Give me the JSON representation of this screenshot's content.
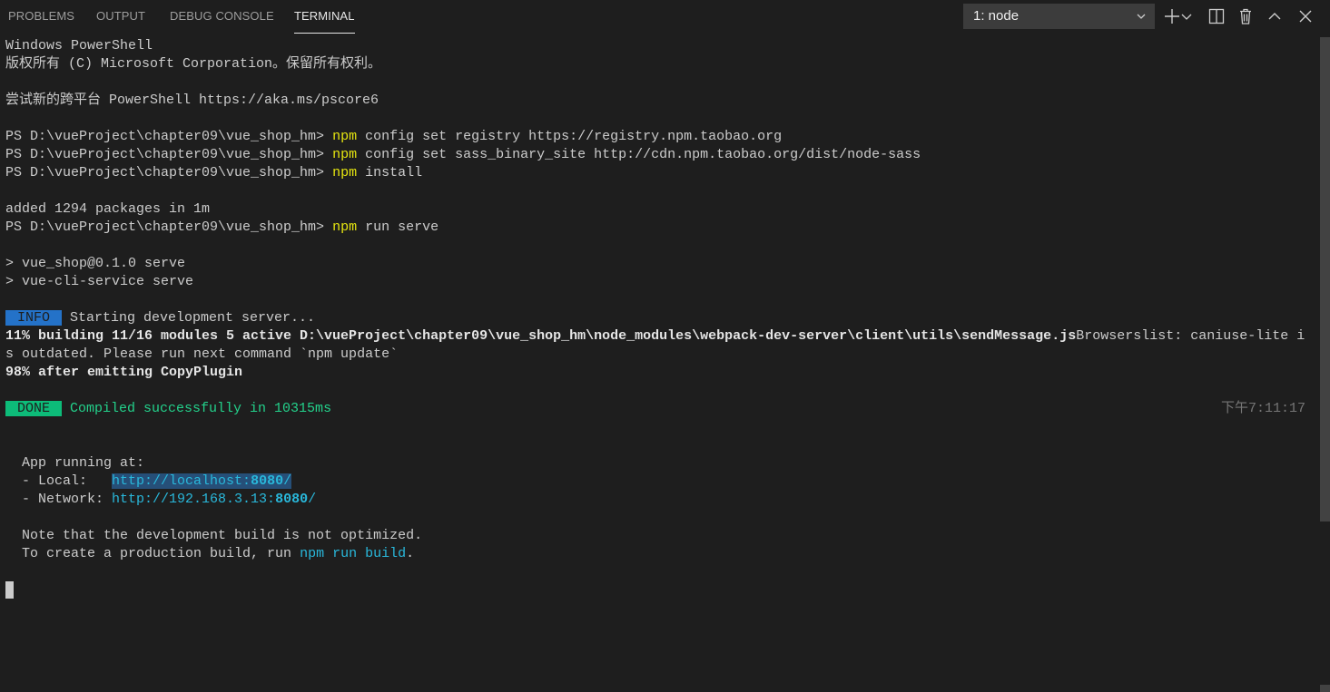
{
  "tabs": [
    {
      "label": "PROBLEMS",
      "active": false
    },
    {
      "label": "OUTPUT",
      "active": false
    },
    {
      "label": "DEBUG CONSOLE",
      "active": false
    },
    {
      "label": "TERMINAL",
      "active": true
    }
  ],
  "terminal_select": {
    "value": "1: node"
  },
  "header_icons": [
    "plus-icon",
    "chevron-down-icon",
    "split-icon",
    "trash-icon",
    "chevron-up-icon",
    "close-icon"
  ],
  "terminal": {
    "l1": "Windows PowerShell",
    "l2": "版权所有 (C) Microsoft Corporation。保留所有权利。",
    "l3": "尝试新的跨平台 PowerShell https://aka.ms/pscore6",
    "prompt": "PS D:\\vueProject\\chapter09\\vue_shop_hm> ",
    "npm": "npm",
    "cmd1": " config set registry https://registry.npm.taobao.org",
    "cmd2": " config set sass_binary_site http://cdn.npm.taobao.org/dist/node-sass",
    "cmd3": " install",
    "added": "added 1294 packages in 1m",
    "cmd4": " run serve",
    "serve1": "> vue_shop@0.1.0 serve",
    "serve2": "> vue-cli-service serve",
    "info_badge": " INFO ",
    "info_text": " Starting development server...",
    "building_bold": "11% building 11/16 modules 5 active D:\\vueProject\\chapter09\\vue_shop_hm\\node_modules\\webpack-dev-server\\client\\utils\\sendMessage.js",
    "building_rest": "Browserslist: caniuse-lite i",
    "building_wrap": "s outdated. Please run next command `npm update`",
    "emitting": "98% after emitting CopyPlugin",
    "done_badge": " DONE ",
    "done_text": " Compiled successfully in 10315ms",
    "done_time": "下午7:11:17",
    "app_running": "  App running at:",
    "local_label": "  - Local:   ",
    "local_url_start": "http://localhost:",
    "local_port": "8080",
    "local_url_end": "/",
    "network_label": "  - Network: ",
    "network_url_start": "http://192.168.3.13:",
    "network_port": "8080",
    "network_url_end": "/",
    "note1": "  Note that the development build is not optimized.",
    "note2_start": "  To create a production build, run ",
    "note2_cmd": "npm run build",
    "note2_end": "."
  }
}
